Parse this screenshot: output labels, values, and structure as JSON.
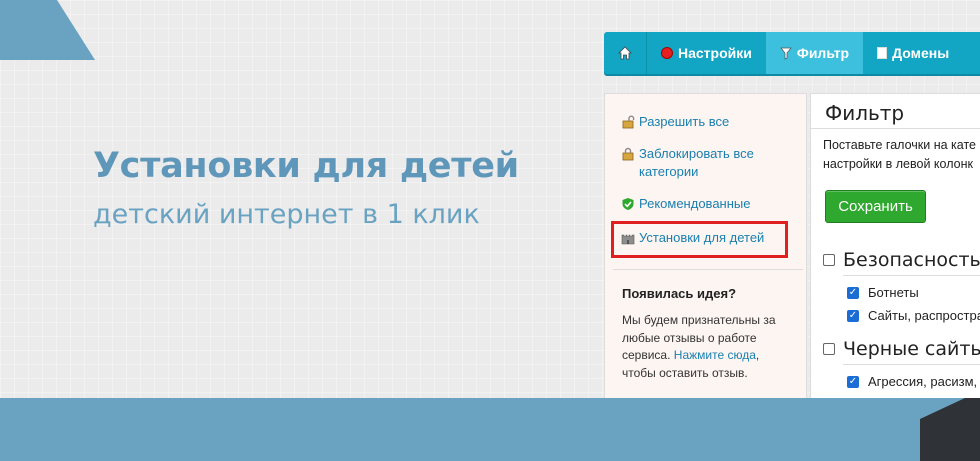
{
  "hero": {
    "title": "Установки для детей",
    "subtitle": "детский интернет в 1 клик"
  },
  "navbar": {
    "items": [
      {
        "label": "",
        "icon": "home-icon"
      },
      {
        "label": "Настройки",
        "icon": "red-dot-icon"
      },
      {
        "label": "Фильтр",
        "icon": "filter-icon"
      },
      {
        "label": "Домены",
        "icon": "document-icon"
      }
    ],
    "active": "Фильтр"
  },
  "sidebar": {
    "links": [
      {
        "label": "Разрешить все",
        "icon": "unlock-icon"
      },
      {
        "label": "Заблокировать все категории",
        "icon": "lock-icon"
      },
      {
        "label": "Рекомендованные",
        "icon": "shield-check-icon"
      },
      {
        "label": "Установки для детей",
        "icon": "castle-icon"
      }
    ],
    "highlighted": "Установки для детей",
    "idea": {
      "title": "Появилась идея?",
      "text_before": "Мы будем признательны за любые отзывы о работе сервиса. ",
      "link": "Нажмите сюда",
      "text_after": ",\nчтобы оставить отзыв."
    }
  },
  "filter_panel": {
    "title": "Фильтр",
    "desc_line1": "Поставьте галочки на кате",
    "desc_line2": "настройки в левой колонк",
    "save_label": "Сохранить",
    "categories": [
      {
        "label": "Безопасность",
        "checked": false,
        "items": [
          {
            "label": "Ботнеты",
            "checked": true
          },
          {
            "label": "Сайты, распростра",
            "checked": true
          }
        ]
      },
      {
        "label": "Черные сайты",
        "checked": false,
        "items": [
          {
            "label": "Агрессия, расизм,",
            "checked": true
          }
        ]
      }
    ]
  },
  "colors": {
    "accent_blue": "#6aa2c2",
    "nav_bg": "#12a5c4",
    "nav_active": "#3cc0de",
    "save_green": "#2fa82f",
    "highlight_red": "#e02020"
  }
}
